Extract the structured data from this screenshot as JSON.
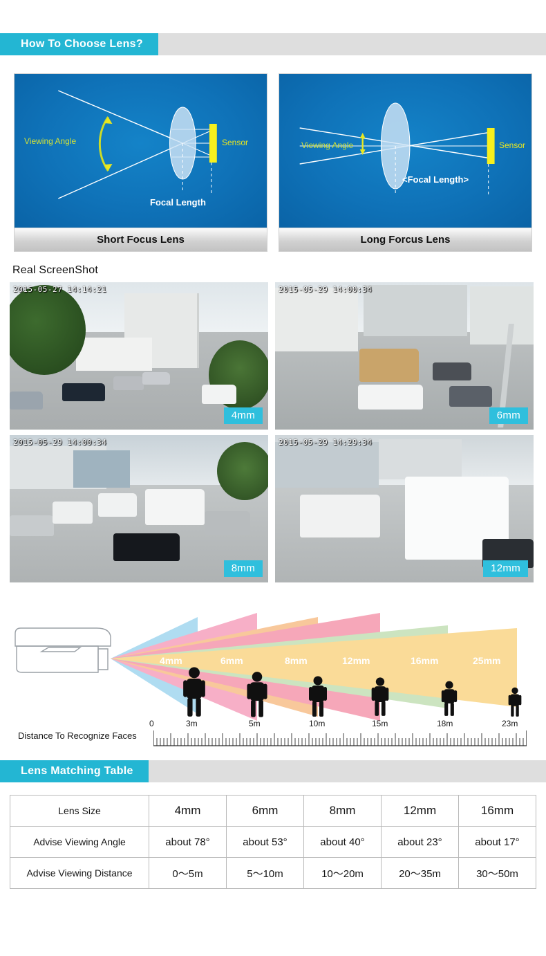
{
  "sections": {
    "choose_lens": "How To Choose Lens?",
    "matching_table": "Lens Matching Table",
    "real_screenshot": "Real ScreenShot"
  },
  "diagrams": [
    {
      "caption": "Short Focus Lens",
      "labels": {
        "viewing_angle": "Viewing Angle",
        "sensor": "Sensor",
        "focal_length": "Focal Length"
      }
    },
    {
      "caption": "Long Forcus Lens",
      "labels": {
        "viewing_angle": "Viewing Angle",
        "sensor": "Sensor",
        "focal_length": "<Focal Length>"
      }
    }
  ],
  "screenshots": [
    {
      "timestamp": "2015-05-27  14:14:21",
      "lens": "4mm"
    },
    {
      "timestamp": "2015-05-29  14:00:34",
      "lens": "6mm"
    },
    {
      "timestamp": "2015-05-29  14:00:34",
      "lens": "8mm"
    },
    {
      "timestamp": "2015-05-29  14:29:34",
      "lens": "12mm"
    }
  ],
  "distance_diagram": {
    "axis_label": "Distance To Recognize Faces",
    "lens_labels": [
      "4mm",
      "6mm",
      "8mm",
      "12mm",
      "16mm",
      "25mm"
    ],
    "ticks": [
      "0",
      "3m",
      "5m",
      "10m",
      "15m",
      "18m",
      "23m"
    ],
    "fan_colors": [
      "#7fc8ea",
      "#f37fa5",
      "#f5a85e",
      "#f2728f",
      "#aed49a",
      "#f7c65a"
    ]
  },
  "chart_data": {
    "type": "bar",
    "title": "Distance To Recognize Faces",
    "xlabel": "Distance",
    "ylabel": "",
    "categories": [
      "4mm",
      "6mm",
      "8mm",
      "12mm",
      "16mm",
      "25mm"
    ],
    "values": [
      3,
      5,
      10,
      15,
      18,
      23
    ],
    "tick_labels": [
      "0",
      "3m",
      "5m",
      "10m",
      "15m",
      "18m",
      "23m"
    ],
    "tick_values": [
      0,
      3,
      5,
      10,
      15,
      18,
      23
    ],
    "xlim": [
      0,
      25
    ],
    "grid": false,
    "legend": "none"
  },
  "table": {
    "rows": [
      {
        "label": "Lens Size",
        "cells": [
          "4mm",
          "6mm",
          "8mm",
          "12mm",
          "16mm"
        ]
      },
      {
        "label": "Advise Viewing Angle",
        "cells": [
          "about 78°",
          "about 53°",
          "about 40°",
          "about 23°",
          "about 17°"
        ]
      },
      {
        "label": "Advise Viewing Distance",
        "cells": [
          "0～5m",
          "5～10m",
          "10～20m",
          "20～35m",
          "30～50m"
        ]
      }
    ]
  },
  "colors": {
    "accent": "#23b6d3",
    "bar_gray": "#dedede",
    "tag_blue": "#2fbfdd",
    "diagram_blue": "#0f72b8",
    "sensor_yellow": "#f7f01e",
    "angle_yellow": "#d9e021"
  }
}
